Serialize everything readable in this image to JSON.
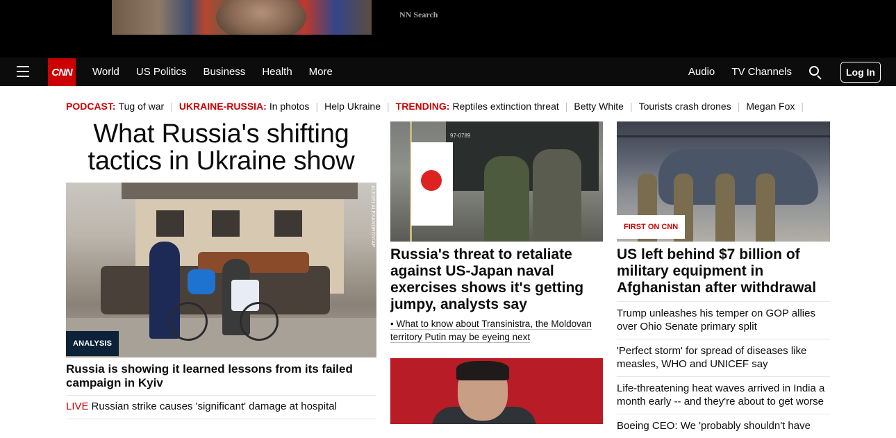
{
  "ad": {
    "text": "NN Search"
  },
  "nav": {
    "logo": "CNN",
    "links": [
      "World",
      "US Politics",
      "Business",
      "Health",
      "More"
    ],
    "right_links": [
      "Audio",
      "TV Channels"
    ],
    "login": "Log In"
  },
  "trending": [
    {
      "label": "PODCAST:",
      "item": "Tug of war"
    },
    {
      "label": "UKRAINE-RUSSIA:",
      "item": "In photos"
    },
    {
      "label": "",
      "item": "Help Ukraine"
    },
    {
      "label": "TRENDING:",
      "item": "Reptiles extinction threat"
    },
    {
      "label": "",
      "item": "Betty White"
    },
    {
      "label": "",
      "item": "Tourists crash drones"
    },
    {
      "label": "",
      "item": "Megan Fox"
    }
  ],
  "col1": {
    "headline": "What Russia's shifting tactics in Ukraine show",
    "photo_credit": "ALEXEI ALEXANDROV/AP",
    "badge": "ANALYSIS",
    "story": "Russia is showing it learned lessons from its failed campaign in Kyiv",
    "live_label": "LIVE",
    "live_text": "Russian strike causes 'significant' damage at hospital"
  },
  "col2": {
    "plate": "97-0789",
    "story": "Russia's threat to retaliate against US-Japan naval exercises shows it's getting jumpy, analysts say",
    "related": "• What to know about Transinistra, the Moldovan territory Putin may be eyeing next"
  },
  "col3": {
    "badge": "FIRST ON CNN",
    "story": "US left behind $7 billion of military equipment in Afghanistan after withdrawal",
    "list": [
      "Trump unleashes his temper on GOP allies over Ohio Senate primary split",
      "'Perfect storm' for spread of diseases like measles, WHO and UNICEF say",
      "Life-threatening heat waves arrived in India a month early -- and they're about to get worse",
      "Boeing CEO: We 'probably shouldn't have"
    ]
  },
  "colors": {
    "brand": "#cc0000",
    "nav_bg": "#0c0c0c",
    "analysis_badge": "#0c2238"
  }
}
